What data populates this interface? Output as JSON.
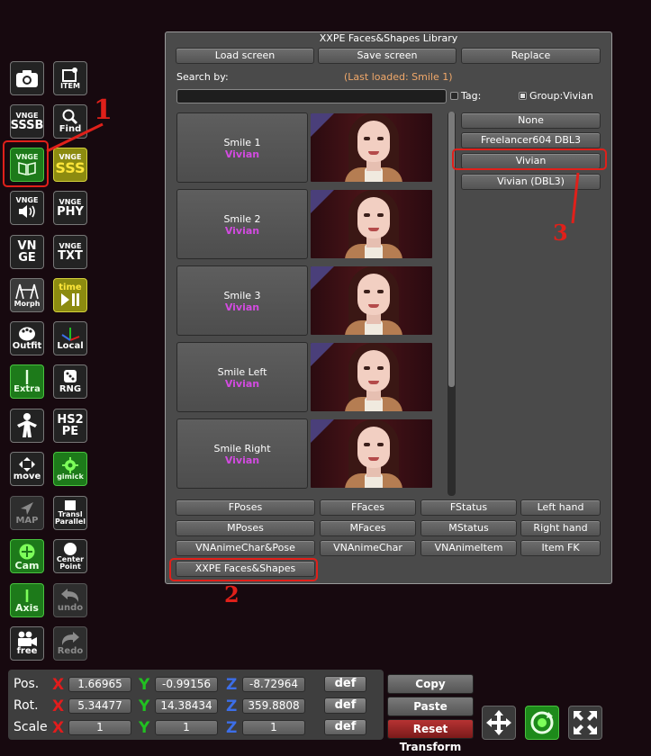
{
  "toolbar": {
    "camera": {
      "label": ""
    },
    "item": {
      "label": "ITEM"
    },
    "vnge_sssb": {
      "top": "VNGE",
      "label": "SSSB"
    },
    "find": {
      "label": "Find"
    },
    "vnge_book": {
      "top": "VNGE"
    },
    "vnge_sss": {
      "top": "VNGE",
      "label": "SSS"
    },
    "vnge_sound": {
      "top": "VNGE"
    },
    "vnge_phy": {
      "top": "VNGE",
      "label": "PHY"
    },
    "vnge": {
      "top": "VN",
      "label": "GE"
    },
    "vnge_txt": {
      "top": "VNGE",
      "label": "TXT"
    },
    "morph": {
      "label": "Morph"
    },
    "time": {
      "top": "time"
    },
    "outfit": {
      "label": "Outfit"
    },
    "local": {
      "label": "Local"
    },
    "extra": {
      "label": "Extra"
    },
    "rng": {
      "label": "RNG"
    },
    "hs2pe": {
      "top": "HS2",
      "label": "PE"
    },
    "move": {
      "label": "move"
    },
    "gimick": {
      "label": "gimick"
    },
    "map": {
      "label": "MAP"
    },
    "transl": {
      "top": "Transl",
      "label": "Parallel"
    },
    "cam": {
      "label": "Cam"
    },
    "center": {
      "top": "Center",
      "label": "Point"
    },
    "axis": {
      "label": "Axis"
    },
    "undo": {
      "label": "undo"
    },
    "free": {
      "label": "free"
    },
    "redo": {
      "label": "Redo"
    }
  },
  "library": {
    "title": "XXPE Faces&Shapes Library",
    "buttons": {
      "load": "Load screen",
      "save": "Save screen",
      "replace": "Replace"
    },
    "search_label": "Search by:",
    "last_loaded": "(Last loaded: Smile 1)",
    "search_value": "",
    "tag_label": "Tag:",
    "group_label": "Group:Vivian",
    "items": [
      {
        "name": "Smile 1",
        "group": "Vivian"
      },
      {
        "name": "Smile 2",
        "group": "Vivian"
      },
      {
        "name": "Smile 3",
        "group": "Vivian"
      },
      {
        "name": "Smile Left",
        "group": "Vivian"
      },
      {
        "name": "Smile Right",
        "group": "Vivian"
      }
    ],
    "groups": [
      "None",
      "Freelancer604 DBL3",
      "Vivian",
      "Vivian (DBL3)"
    ],
    "bottom_rows": [
      [
        "FPoses",
        "FFaces",
        "FStatus",
        "Left hand"
      ],
      [
        "MPoses",
        "MFaces",
        "MStatus",
        "Right hand"
      ],
      [
        "VNAnimeChar&Pose",
        "VNAnimeChar",
        "VNAnimeItem",
        "Item FK"
      ]
    ],
    "xxpe_button": "XXPE Faces&Shapes"
  },
  "annotations": [
    "1",
    "2",
    "3"
  ],
  "transform": {
    "pos_label": "Pos.",
    "rot_label": "Rot.",
    "scale_label": "Scale",
    "x": "X",
    "y": "Y",
    "z": "Z",
    "pos": [
      "1.66965",
      "-0.99156",
      "-8.72964"
    ],
    "rot": [
      "5.34477",
      "14.38434",
      "359.8808"
    ],
    "scale": [
      "1",
      "1",
      "1"
    ],
    "def": "def",
    "copy": "Copy Transform",
    "paste": "Paste Transform",
    "reset": "Reset Transform"
  }
}
